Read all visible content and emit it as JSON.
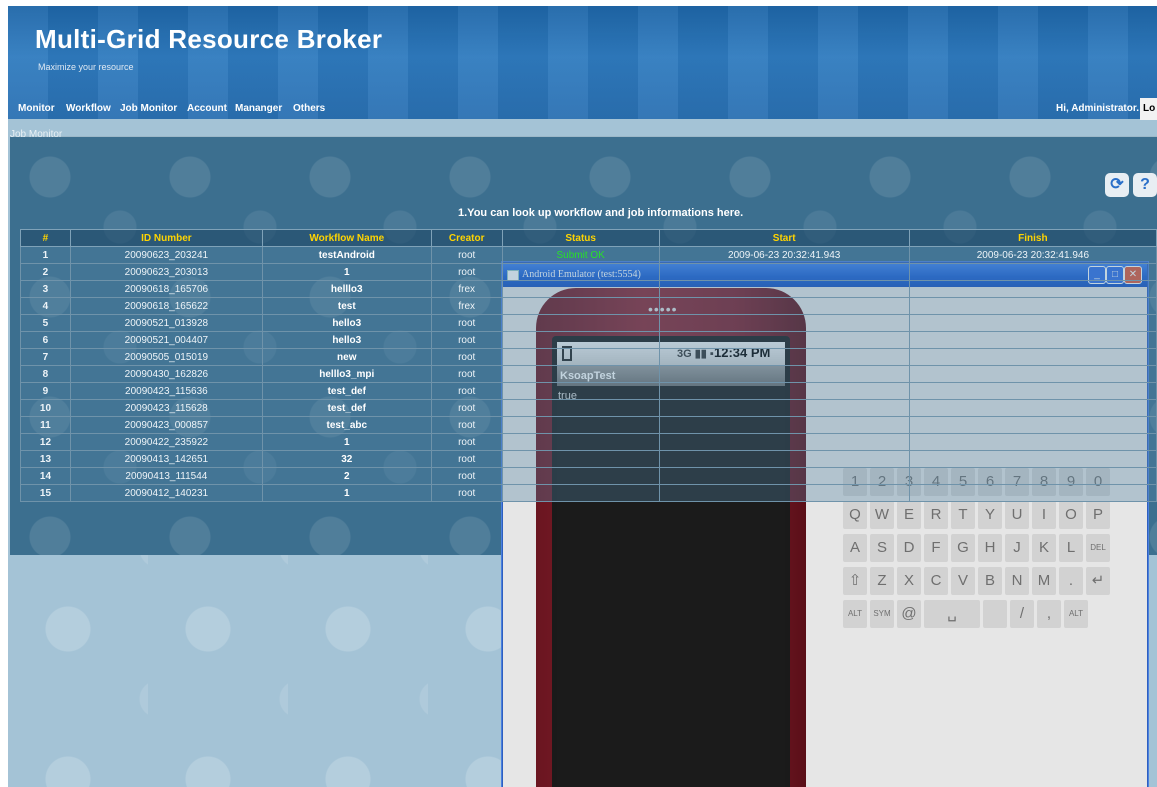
{
  "header": {
    "title": "Multi-Grid Resource Broker",
    "subtitle": "Maximize your resource",
    "nav": [
      "Monitor",
      "Workflow",
      "Job Monitor",
      "Account",
      "Mananger",
      "Others"
    ],
    "greeting": "Hi, Administrator.",
    "logout_label": "Lo"
  },
  "job_monitor": {
    "legend": "Job Monitor",
    "info": "1.You can look up workflow and job informations here.",
    "columns": [
      "#",
      "ID Number",
      "Workflow Name",
      "Creator",
      "Status",
      "Start",
      "Finish"
    ],
    "rows": [
      [
        "1",
        "20090623_203241",
        "testAndroid",
        "root",
        "Submit OK",
        "2009-06-23 20:32:41.943",
        "2009-06-23 20:32:41.946"
      ],
      [
        "2",
        "20090623_203013",
        "1",
        "root",
        "",
        "",
        ""
      ],
      [
        "3",
        "20090618_165706",
        "helllo3",
        "frex",
        "",
        "",
        ""
      ],
      [
        "4",
        "20090618_165622",
        "test",
        "frex",
        "",
        "",
        ""
      ],
      [
        "5",
        "20090521_013928",
        "hello3",
        "root",
        "",
        "",
        ""
      ],
      [
        "6",
        "20090521_004407",
        "hello3",
        "root",
        "",
        "",
        ""
      ],
      [
        "7",
        "20090505_015019",
        "new",
        "root",
        "",
        "",
        ""
      ],
      [
        "8",
        "20090430_162826",
        "helllo3_mpi",
        "root",
        "",
        "",
        ""
      ],
      [
        "9",
        "20090423_115636",
        "test_def",
        "root",
        "",
        "",
        ""
      ],
      [
        "10",
        "20090423_115628",
        "test_def",
        "root",
        "",
        "",
        ""
      ],
      [
        "11",
        "20090423_000857",
        "test_abc",
        "root",
        "",
        "",
        ""
      ],
      [
        "12",
        "20090422_235922",
        "1",
        "root",
        "",
        "",
        ""
      ],
      [
        "13",
        "20090413_142651",
        "32",
        "root",
        "",
        "",
        ""
      ],
      [
        "14",
        "20090413_111544",
        "2",
        "root",
        "",
        "",
        ""
      ],
      [
        "15",
        "20090412_140231",
        "1",
        "root",
        "",
        "",
        ""
      ]
    ]
  },
  "emulator": {
    "title": "Android Emulator (test:5554)",
    "status_time": "12:34 PM",
    "status_net": "3G",
    "app_name": "KsoapTest",
    "result_text": "true",
    "keyboard": {
      "row1": [
        "1",
        "2",
        "3",
        "4",
        "5",
        "6",
        "7",
        "8",
        "9",
        "0"
      ],
      "row2": [
        "Q",
        "W",
        "E",
        "R",
        "T",
        "Y",
        "U",
        "I",
        "O",
        "P"
      ],
      "row3": [
        "A",
        "S",
        "D",
        "F",
        "G",
        "H",
        "J",
        "K",
        "L",
        "DEL"
      ],
      "row4": [
        "⇧",
        "Z",
        "X",
        "C",
        "V",
        "B",
        "N",
        "M",
        ".",
        "↵"
      ],
      "row5": [
        "ALT",
        "SYM",
        "@",
        "␣",
        "",
        "/",
        ",",
        "ALT"
      ]
    }
  }
}
